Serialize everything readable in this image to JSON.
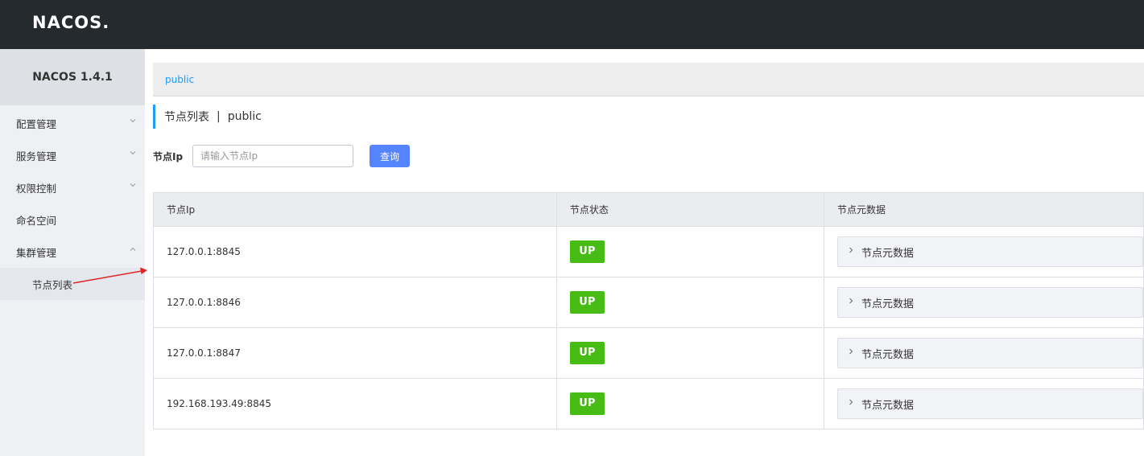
{
  "header": {
    "logo_text": "NACOS."
  },
  "sidebar": {
    "version": "NACOS 1.4.1",
    "items": [
      {
        "label": "配置管理",
        "chevron": "down"
      },
      {
        "label": "服务管理",
        "chevron": "down"
      },
      {
        "label": "权限控制",
        "chevron": "down"
      },
      {
        "label": "命名空间",
        "chevron": "none"
      },
      {
        "label": "集群管理",
        "chevron": "up"
      }
    ],
    "sub_items": [
      {
        "label": "节点列表"
      }
    ]
  },
  "breadcrumb": {
    "namespace": "public"
  },
  "page_title": {
    "title": "节点列表",
    "separator": "|",
    "namespace": "public"
  },
  "search": {
    "label": "节点Ip",
    "placeholder": "请输入节点Ip",
    "button": "查询"
  },
  "table": {
    "headers": [
      "节点Ip",
      "节点状态",
      "节点元数据"
    ],
    "rows": [
      {
        "ip": "127.0.0.1:8845",
        "status": "UP",
        "meta": "节点元数据"
      },
      {
        "ip": "127.0.0.1:8846",
        "status": "UP",
        "meta": "节点元数据"
      },
      {
        "ip": "127.0.0.1:8847",
        "status": "UP",
        "meta": "节点元数据"
      },
      {
        "ip": "192.168.193.49:8845",
        "status": "UP",
        "meta": "节点元数据"
      }
    ]
  },
  "colors": {
    "accent": "#209bfa",
    "primary_button": "#5584ff",
    "status_up": "#46bc15",
    "topbar": "#252a2f",
    "annotation_arrow": "#e02424"
  },
  "icons": {
    "logo": "nacos-logo",
    "menu_chevron": "chevron-icon",
    "meta_expand": "chevron-right-icon",
    "annotation": "red-arrow-annotation"
  }
}
